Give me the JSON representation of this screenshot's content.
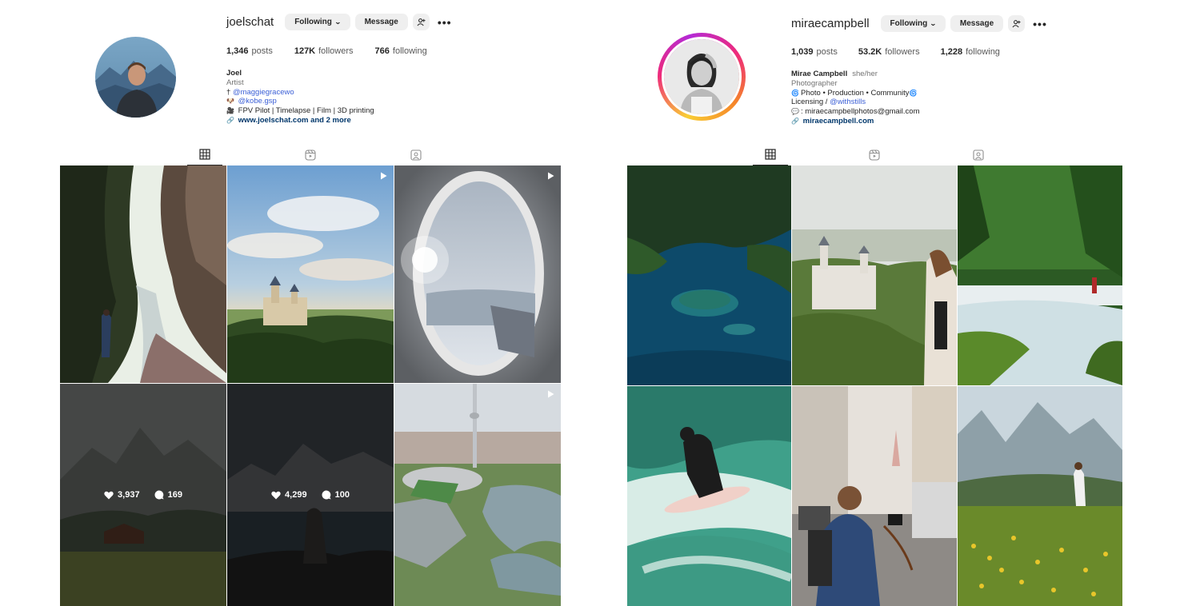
{
  "left": {
    "username": "joelschat",
    "following_btn": "Following",
    "message_btn": "Message",
    "stats": {
      "posts_count": "1,346",
      "posts_label": "posts",
      "followers_count": "127K",
      "followers_label": "followers",
      "following_count": "766",
      "following_label": "following"
    },
    "bio": {
      "name": "Joel",
      "category": "Artist",
      "line1_prefix": "†",
      "line1_link": "@maggiegracewo",
      "line2_link": "@kobe.gsp",
      "line3": "FPV Pilot | Timelapse | Film | 3D printing",
      "url": "www.joelschat.com and 2 more"
    },
    "posts": [
      {
        "type": "photo"
      },
      {
        "type": "reel"
      },
      {
        "type": "reel"
      },
      {
        "type": "photo",
        "likes": "3,937",
        "comments": "169"
      },
      {
        "type": "photo",
        "likes": "4,299",
        "comments": "100"
      },
      {
        "type": "reel"
      }
    ]
  },
  "right": {
    "username": "miraecampbell",
    "following_btn": "Following",
    "message_btn": "Message",
    "stats": {
      "posts_count": "1,039",
      "posts_label": "posts",
      "followers_count": "53.2K",
      "followers_label": "followers",
      "following_count": "1,228",
      "following_label": "following"
    },
    "bio": {
      "name": "Mirae Campbell",
      "pronouns": "she/her",
      "category": "Photographer",
      "line1": "Photo • Production • Community",
      "line2_prefix": "Licensing / ",
      "line2_link": "@withstills",
      "line3": ": miraecampbellphotos@gmail.com",
      "url": "miraecampbell.com"
    }
  },
  "icons": [
    "chevron-down-icon",
    "suggest-user-icon",
    "more-icon",
    "grid-icon",
    "reels-icon",
    "tagged-icon",
    "reel-badge-icon",
    "heart-icon",
    "comment-icon",
    "link-icon"
  ]
}
